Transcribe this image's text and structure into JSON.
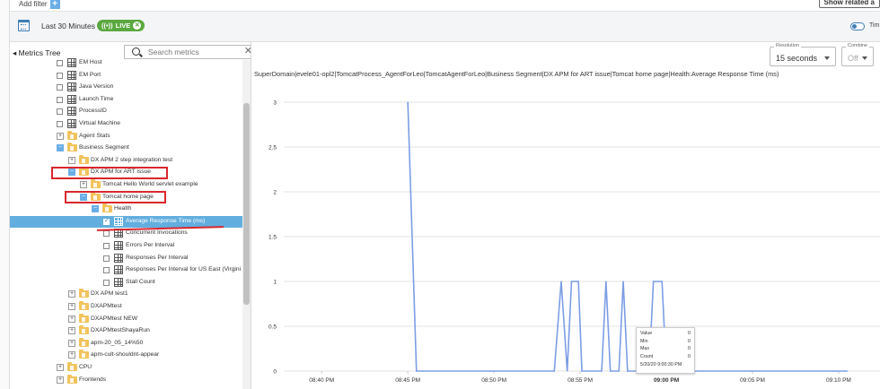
{
  "toolbar": {
    "add_filter_label": "Add filter",
    "show_related_label": "Show related a"
  },
  "timebar": {
    "range_label": "Last 30 Minutes",
    "live_label": "LIVE",
    "toggle_label": "Tim"
  },
  "tree": {
    "title": "Metrics Tree",
    "search_placeholder": "Search metrics",
    "items": [
      {
        "label": "EM Host",
        "kind": "metric",
        "ctrl": "check"
      },
      {
        "label": "EM Port",
        "kind": "metric",
        "ctrl": "check"
      },
      {
        "label": "Java Version",
        "kind": "metric",
        "ctrl": "check"
      },
      {
        "label": "Launch Time",
        "kind": "metric",
        "ctrl": "check"
      },
      {
        "label": "ProcessID",
        "kind": "metric",
        "ctrl": "check"
      },
      {
        "label": "Virtual Machine",
        "kind": "metric",
        "ctrl": "check"
      },
      {
        "label": "Agent Stats",
        "kind": "folder",
        "ctrl": "plus"
      },
      {
        "label": "Business Segment",
        "kind": "folder",
        "ctrl": "minus"
      },
      {
        "label": "DX APM 2 step integration test",
        "kind": "folder",
        "ctrl": "plus"
      },
      {
        "label": "DX APM for ART issue",
        "kind": "folder",
        "ctrl": "minus"
      },
      {
        "label": "Tomcat Hello World servlet example",
        "kind": "folder",
        "ctrl": "plus"
      },
      {
        "label": "Tomcat home page",
        "kind": "folder",
        "ctrl": "minus"
      },
      {
        "label": "Health",
        "kind": "folder",
        "ctrl": "minus"
      },
      {
        "label": "Average Response Time (ms)",
        "kind": "metric",
        "ctrl": "check"
      },
      {
        "label": "Concurrent Invocations",
        "kind": "metric",
        "ctrl": "check"
      },
      {
        "label": "Errors Per Interval",
        "kind": "metric",
        "ctrl": "check"
      },
      {
        "label": "Responses Per Interval",
        "kind": "metric",
        "ctrl": "check"
      },
      {
        "label": "Responses Per Interval for US East (Virgini",
        "kind": "metric",
        "ctrl": "check"
      },
      {
        "label": "Stall Count",
        "kind": "metric",
        "ctrl": "check"
      },
      {
        "label": "DX APM test1",
        "kind": "folder",
        "ctrl": "plus"
      },
      {
        "label": "DXAPMtest",
        "kind": "folder",
        "ctrl": "plus"
      },
      {
        "label": "DXAPMtest NEW",
        "kind": "folder",
        "ctrl": "plus"
      },
      {
        "label": "DXAPMtestShayaRun",
        "kind": "folder",
        "ctrl": "plus"
      },
      {
        "label": "apm-20_05_14%50",
        "kind": "folder",
        "ctrl": "plus"
      },
      {
        "label": "apm-cult-shouldnt-appear",
        "kind": "folder",
        "ctrl": "plus"
      },
      {
        "label": "CPU",
        "kind": "folder",
        "ctrl": "plus"
      },
      {
        "label": "Frontends",
        "kind": "folder",
        "ctrl": "plus"
      }
    ],
    "selected_label": "Average Response Time (ms)"
  },
  "controls": {
    "resolution_legend": "Resolution",
    "resolution_value": "15 seconds",
    "combine_legend": "Combine",
    "combine_value": "Off"
  },
  "chart": {
    "metric_path": "SuperDomain|evele01-opl2|TomcatProcess_AgentForLeo|TomcatAgentForLeo|Business Segment|DX APM for ART issue|Tomcat home page|Health:Average Response Time (ms)"
  },
  "tooltip": {
    "rows": [
      {
        "k": "Value",
        "v": "0"
      },
      {
        "k": "Min",
        "v": "0"
      },
      {
        "k": "Max",
        "v": "0"
      },
      {
        "k": "Count",
        "v": "0"
      }
    ],
    "timestamp": "5/20/20 9:00:30 PM"
  },
  "colors": {
    "line": "#7c9de6",
    "accent": "#62aede",
    "live": "#5aa83f",
    "highlight": "#d9272e"
  },
  "chart_data": {
    "type": "line",
    "title": "",
    "xlabel": "",
    "ylabel": "",
    "ylim": [
      0,
      3
    ],
    "yticks": [
      "0",
      "0.5",
      "1",
      "1.5",
      "2",
      "2.5",
      "3"
    ],
    "xticks": [
      "08:40 PM",
      "08:45 PM",
      "08:50 PM",
      "08:55 PM",
      "09:00 PM",
      "09:05 PM",
      "09:10 PM"
    ],
    "x_unit": "minutes after 08:40 PM",
    "series": [
      {
        "values_x": [
          5.0,
          5.5,
          5.75,
          6.0,
          6.25,
          6.5,
          6.75,
          7.0,
          7.25,
          7.75,
          8.0,
          8.25,
          8.5,
          8.75,
          9.0,
          10.0,
          10.25,
          10.5,
          10.75,
          11.0,
          11.25,
          11.5,
          11.75,
          12.0,
          12.25,
          12.5,
          13.0,
          13.25,
          13.5,
          13.75,
          14.0,
          14.25,
          15.0,
          16.0,
          16.25,
          16.75,
          17.0,
          17.25,
          17.5,
          18.0,
          18.25,
          18.5,
          18.75,
          19.0,
          19.25,
          20.0,
          21.0,
          25.0,
          30.0,
          30.5
        ],
        "values_y": [
          3,
          0,
          0,
          0,
          0,
          0,
          0,
          0,
          0,
          0,
          0,
          0,
          0,
          0,
          0,
          0,
          0,
          0,
          0,
          0,
          0,
          0,
          0,
          0,
          0,
          0,
          0,
          0,
          0,
          0,
          0,
          0,
          0,
          0,
          0,
          0,
          0,
          0,
          0,
          0,
          0,
          0,
          0,
          0,
          0,
          0,
          0,
          0,
          0,
          0
        ]
      }
    ],
    "points": [
      [
        5.0,
        3
      ],
      [
        5.5,
        0
      ],
      [
        13.5,
        0
      ],
      [
        13.9,
        1
      ],
      [
        14.25,
        0
      ],
      [
        14.5,
        1
      ],
      [
        14.9,
        1
      ],
      [
        15.1,
        0
      ],
      [
        16.25,
        0
      ],
      [
        16.5,
        1
      ],
      [
        16.75,
        0
      ],
      [
        17.25,
        0
      ],
      [
        17.5,
        1
      ],
      [
        17.75,
        0
      ],
      [
        19.0,
        0
      ],
      [
        19.25,
        1
      ],
      [
        19.75,
        1
      ],
      [
        20.0,
        0
      ],
      [
        30.5,
        0
      ]
    ]
  }
}
